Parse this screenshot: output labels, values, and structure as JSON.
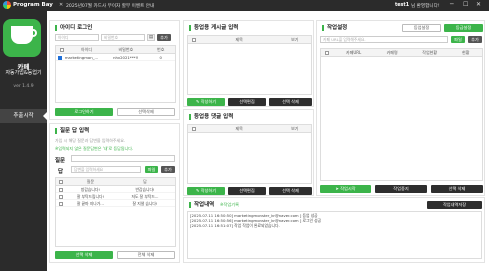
{
  "topbar": {
    "app_name": "Program Bay",
    "notice": "2025년07월 카드사 무이자 할부 이벤트 안내",
    "user": "test1",
    "user_suffix": "님 환영합니다!",
    "win_min": "─",
    "win_max": "☐",
    "win_close": "✕",
    "accent": "#3cb44a"
  },
  "sidebar": {
    "brand_name": "카페",
    "brand_sub": "자동가입&등업기",
    "version": "ver 1.4.9",
    "nav_active": "추출시작"
  },
  "id_login": {
    "title": "아이디 로그인",
    "id_placeholder": "아이디",
    "pw_placeholder": "비밀번호",
    "add_label": "추가",
    "columns": [
      "",
      "아이디",
      "비밀번호",
      "번호"
    ],
    "rows": [
      {
        "checked": true,
        "id": "marketingmon_...",
        "pw": "nhv2021***!!",
        "num": "0"
      }
    ],
    "btn_login": "로그인하기",
    "btn_delete": "선택삭제"
  },
  "qa": {
    "title": "질문 답 입력",
    "hint1": "가입 시 해당 질문과 답변을 입력하주세요.",
    "hint2": "※입력되지 않은 질문답변은 '내'로 등답됩니다.",
    "question_label": "질문",
    "answer_label": "답",
    "answer_placeholder": "답변을 입력하세요",
    "file_label": "파일",
    "add_label": "추가",
    "columns": [
      "",
      "질문",
      "답"
    ],
    "rows": [
      {
        "q": "방갑습니다!",
        "a": "반갑습니다!"
      },
      {
        "q": "잘 부탁드립니다!",
        "a": "저도 잘 부탁드..."
      },
      {
        "q": "잘 끝마 지나가...",
        "a": "잘 지낼 습니다!"
      }
    ],
    "btn_selected_delete": "선택 삭제",
    "btn_all_delete": "전체 삭제"
  },
  "post": {
    "title": "등업용 게시글 입력",
    "columns": [
      "",
      "제목",
      "보기"
    ],
    "btn_write": "작성하기",
    "btn_edit": "선택편집",
    "btn_delete": "선택 삭제"
  },
  "comment": {
    "title": "등업용 댓글 입력",
    "columns": [
      "",
      "제목",
      "보기"
    ],
    "btn_write": "작성하기",
    "btn_edit": "선택편집",
    "btn_delete": "선택 삭제"
  },
  "job": {
    "title": "작업설정",
    "btn_level_settings": "등업설정",
    "btn_join_settings": "등급설정",
    "url_placeholder": "카페 URL을 입력해주세요.",
    "file_label": "파일",
    "add_label": "추가",
    "columns": [
      "",
      "카페URL",
      "카페명",
      "작업현황",
      "현황"
    ],
    "btn_start": "작업시작",
    "btn_stop": "작업중지",
    "btn_delete": "선택 삭제"
  },
  "history": {
    "title": "작업내역",
    "link": "※작업기록",
    "btn_save": "작업내역저장",
    "logs": [
      "[2025.07.11 16:50:50] marketingmonster_kr@naver.com ] 등업 성공",
      "[2025.07.11 16:50:56] marketingmonster_kr@naver.com ] 로그인 성공",
      "[2025.07.11 16:51:07] 작업 작업이 완료되었습니다."
    ]
  }
}
